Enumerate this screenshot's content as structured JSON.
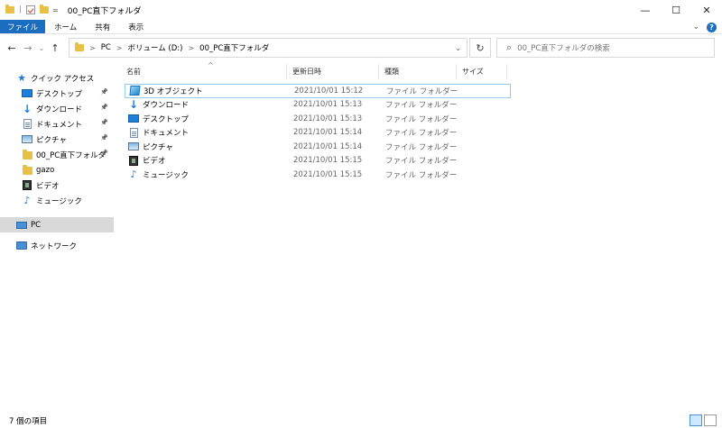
{
  "window": {
    "title": "00_PC直下フォルダ",
    "qat_separator": "|",
    "qat_dropdown": "=",
    "controls": {
      "minimize": "—",
      "maximize": "☐",
      "close": "✕"
    }
  },
  "ribbon": {
    "tabs": [
      {
        "label": "ファイル",
        "active": true
      },
      {
        "label": "ホーム"
      },
      {
        "label": "共有"
      },
      {
        "label": "表示"
      }
    ],
    "collapse_glyph": "⌄",
    "help_glyph": "?"
  },
  "address": {
    "back": "←",
    "forward": "→",
    "recent": "⌄",
    "up": "↑",
    "breadcrumbs": [
      "PC",
      "ボリューム (D:)",
      "00_PC直下フォルダ"
    ],
    "crumb_separator": ">",
    "dropdown": "⌄",
    "refresh": "↻"
  },
  "search": {
    "icon": "⌕",
    "placeholder": "00_PC直下フォルダの検索"
  },
  "nav": {
    "quick_access": {
      "label": "クイック アクセス",
      "icon": "star-icon"
    },
    "quick_items": [
      {
        "label": "デスクトップ",
        "icon": "desktop-icon",
        "pinned": true
      },
      {
        "label": "ダウンロード",
        "icon": "download-arrow-icon",
        "pinned": true
      },
      {
        "label": "ドキュメント",
        "icon": "document-icon",
        "pinned": true
      },
      {
        "label": "ピクチャ",
        "icon": "pictures-icon",
        "pinned": true
      },
      {
        "label": "00_PC直下フォルダ",
        "icon": "folder-icon",
        "pinned": true
      },
      {
        "label": "gazo",
        "icon": "folder-icon",
        "pinned": false
      },
      {
        "label": "ビデオ",
        "icon": "video-icon",
        "pinned": false
      },
      {
        "label": "ミュージック",
        "icon": "music-icon",
        "pinned": false
      }
    ],
    "pin_glyph": "📌",
    "pc": {
      "label": "PC",
      "icon": "pc-icon",
      "selected": true
    },
    "network": {
      "label": "ネットワーク",
      "icon": "network-icon"
    }
  },
  "columns": {
    "name": "名前",
    "date": "更新日時",
    "type": "種類",
    "size": "サイズ",
    "sort_glyph": "^"
  },
  "files": [
    {
      "name": "3D オブジェクト",
      "date": "2021/10/01 15:12",
      "type": "ファイル フォルダー",
      "icon": "3d-objects-icon"
    },
    {
      "name": "ダウンロード",
      "date": "2021/10/01 15:13",
      "type": "ファイル フォルダー",
      "icon": "download-arrow-icon"
    },
    {
      "name": "デスクトップ",
      "date": "2021/10/01 15:13",
      "type": "ファイル フォルダー",
      "icon": "desktop-icon"
    },
    {
      "name": "ドキュメント",
      "date": "2021/10/01 15:14",
      "type": "ファイル フォルダー",
      "icon": "document-icon"
    },
    {
      "name": "ピクチャ",
      "date": "2021/10/01 15:14",
      "type": "ファイル フォルダー",
      "icon": "pictures-icon"
    },
    {
      "name": "ビデオ",
      "date": "2021/10/01 15:15",
      "type": "ファイル フォルダー",
      "icon": "video-icon"
    },
    {
      "name": "ミュージック",
      "date": "2021/10/01 15:15",
      "type": "ファイル フォルダー",
      "icon": "music-icon"
    }
  ],
  "status": {
    "item_count": "7 個の項目"
  },
  "colors": {
    "accent": "#1a6dbf",
    "selection": "#d9d9d9",
    "focus_border": "#99c9ef",
    "folder": "#e9c046"
  }
}
